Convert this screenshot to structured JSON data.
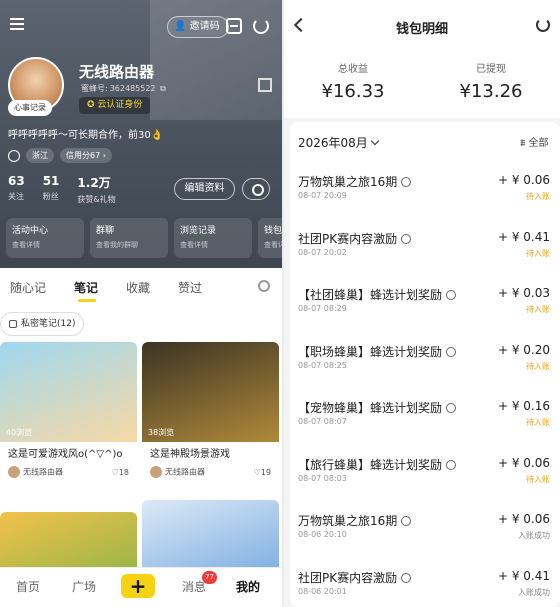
{
  "left": {
    "invite_label": "邀请码",
    "username": "无线路由器",
    "uid_label": "蜜蜂号:",
    "uid_value": "362485522",
    "verify_label": "云认证身份",
    "mood_label": "心事记录",
    "bio": "呼呼呼呼呼～可长期合作，前30👌",
    "location": "浙江",
    "credit": "信用分67",
    "stats": [
      {
        "num": "63",
        "label": "关注"
      },
      {
        "num": "51",
        "label": "粉丝"
      },
      {
        "num": "1.2万",
        "label": "获赞&礼物"
      }
    ],
    "edit_label": "编辑资料",
    "cards": [
      {
        "title": "活动中心",
        "sub": "查看详情"
      },
      {
        "title": "群聊",
        "sub": "查看我的群聊"
      },
      {
        "title": "浏览记录",
        "sub": "查看详情"
      },
      {
        "title": "钱包",
        "sub": "查看详情"
      }
    ],
    "tabs": [
      "随心记",
      "笔记",
      "收藏",
      "赞过"
    ],
    "private_label": "私密笔记(12)",
    "posts": [
      {
        "views": "40浏览",
        "title": "这是可爱游戏风o(^▽^)o",
        "author": "无线路由器",
        "likes": "18",
        "colors": [
          "#9fd7ef",
          "#f7d9a6"
        ]
      },
      {
        "views": "38浏览",
        "title": "这是神殿场景游戏",
        "author": "无线路由器",
        "likes": "19",
        "colors": [
          "#3b3324",
          "#b08a3a"
        ]
      },
      {
        "views": "",
        "title": "",
        "author": "",
        "likes": "",
        "colors": [
          "#f2c24a",
          "#7ab04a"
        ]
      },
      {
        "views": "",
        "title": "",
        "author": "",
        "likes": "",
        "colors": [
          "#dce9f6",
          "#6aa2dd"
        ]
      }
    ],
    "nav": {
      "home": "首页",
      "square": "广场",
      "plus": "+",
      "msg": "消息",
      "badge": "77",
      "me": "我的"
    }
  },
  "right": {
    "title": "钱包明细",
    "total_label": "总收益",
    "total_value": "¥16.33",
    "withdrawn_label": "已提现",
    "withdrawn_value": "¥13.26",
    "month": "2026年08月",
    "filter": "全部",
    "items": [
      {
        "name": "万物筑巢之旅16期",
        "date": "08-07 20:09",
        "amount": "+ ¥ 0.06",
        "status": "待入账",
        "status_color": "#e8a612"
      },
      {
        "name": "社团PK赛内容激励",
        "date": "08-07 20:02",
        "amount": "+ ¥ 0.41",
        "status": "待入账",
        "status_color": "#e8a612"
      },
      {
        "name": "【社团蜂巢】蜂选计划奖励",
        "date": "08-07 08:29",
        "amount": "+ ¥ 0.03",
        "status": "待入账",
        "status_color": "#e8a612"
      },
      {
        "name": "【职场蜂巢】蜂选计划奖励",
        "date": "08-07 08:25",
        "amount": "+ ¥ 0.20",
        "status": "待入账",
        "status_color": "#e8a612"
      },
      {
        "name": "【宠物蜂巢】蜂选计划奖励",
        "date": "08-07 08:07",
        "amount": "+ ¥ 0.16",
        "status": "待入账",
        "status_color": "#e8a612"
      },
      {
        "name": "【旅行蜂巢】蜂选计划奖励",
        "date": "08-07 08:03",
        "amount": "+ ¥ 0.06",
        "status": "待入账",
        "status_color": "#e8a612"
      },
      {
        "name": "万物筑巢之旅16期",
        "date": "08-06 20:10",
        "amount": "+ ¥ 0.06",
        "status": "入账成功",
        "status_color": "#888888"
      },
      {
        "name": "社团PK赛内容激励",
        "date": "08-06 20:01",
        "amount": "+ ¥ 0.41",
        "status": "入账成功",
        "status_color": "#888888"
      }
    ]
  }
}
